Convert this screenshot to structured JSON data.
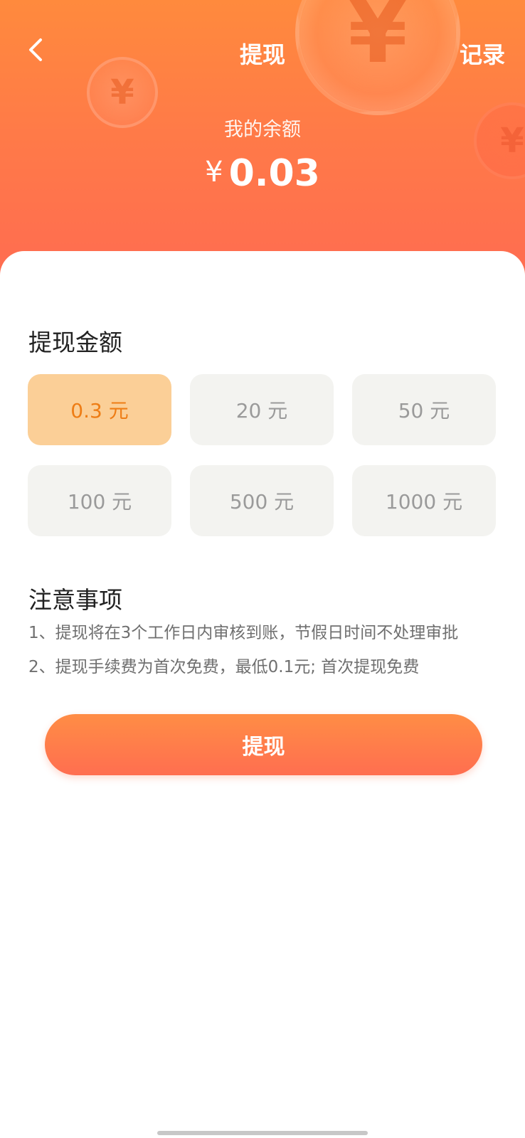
{
  "nav": {
    "title": "提现",
    "records_label": "记录",
    "back_icon": "chevron-left-icon"
  },
  "decor": {
    "coin_symbol": "¥"
  },
  "balance": {
    "label": "我的余额",
    "currency": "¥",
    "amount": "0.03"
  },
  "amount_section": {
    "title": "提现金额",
    "options": [
      {
        "label": "0.3 元",
        "selected": true
      },
      {
        "label": "20 元",
        "selected": false
      },
      {
        "label": "50 元",
        "selected": false
      },
      {
        "label": "100 元",
        "selected": false
      },
      {
        "label": "500 元",
        "selected": false
      },
      {
        "label": "1000 元",
        "selected": false
      }
    ]
  },
  "notes_section": {
    "title": "注意事项",
    "items": [
      "1、提现将在3个工作日内审核到账，节假日时间不处理审批",
      "2、提现手续费为首次免费，最低0.1元; 首次提现免费"
    ]
  },
  "submit": {
    "label": "提现"
  },
  "colors": {
    "brand_orange": "#ff7a48",
    "selected_bg": "#fbcf97",
    "selected_text": "#ee7d15"
  }
}
